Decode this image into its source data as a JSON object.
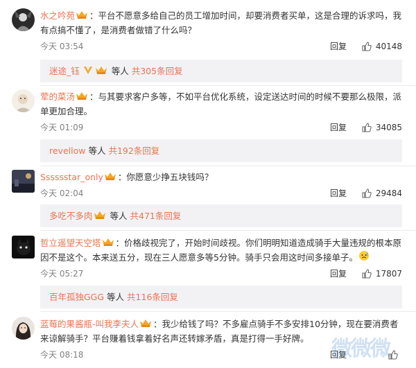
{
  "badge_icon": "crown-badge-icon",
  "thumbs_icon": "thumbs-up-icon",
  "colors": {
    "username": "#eb7350",
    "reply_bg": "#f2f2f5",
    "meta": "#808080"
  },
  "comments": [
    {
      "user": "水之吟苑",
      "text": "：平台不愿意多给自己的员工增加时间，却要消费者买单，这是合理的诉求吗，我有点搞不懂了，是消费者做错了什么吗？",
      "time": "今天 03:54",
      "reply_label": "回复",
      "likes": "40148",
      "replies": {
        "users": "迷途_钰",
        "suffix": "等人",
        "count": "共305条回复"
      }
    },
    {
      "user": "荤的菜汤",
      "text": "：与其要求客户多等，不如平台优化系统，设定送达时间的时候不要那么极限，派单更加合理。",
      "time": "今天 01:09",
      "reply_label": "回复",
      "likes": "34085",
      "replies": {
        "users": "revellow",
        "suffix": "等人",
        "count": "共192条回复"
      }
    },
    {
      "user": "Sssssstar_only",
      "text": "：你愿意少挣五块钱吗？",
      "time": "今天 02:04",
      "reply_label": "回复",
      "likes": "29484",
      "replies": {
        "users": "多吃不多肉",
        "suffix": "等人",
        "count": "共471条回复"
      }
    },
    {
      "user": "哲立遥望天空塔",
      "text": "：价格歧视完了，开始时间歧视。你们明明知道造成骑手大量违规的根本原因不是这个。本来送五分，现在三人愿意多等5分钟。骑手只会用这时间多接单子。",
      "time": "今天 05:27",
      "reply_label": "回复",
      "likes": "17807",
      "replies": {
        "users": "百年孤独GGG",
        "suffix": "等人",
        "count": "共116条回复"
      }
    },
    {
      "user": "蓝莓的果酱瓶-叫我李夫人",
      "text": "：我少给钱了吗？不多雇点骑手不多安排10分钟，现在要消费者来谅解骑手？平台赚着钱拿着好名声还转嫁矛盾，真是打得一手好牌。",
      "time": "今天 08:18",
      "reply_label": "回复",
      "likes": ""
    }
  ],
  "watermark": "微微微"
}
